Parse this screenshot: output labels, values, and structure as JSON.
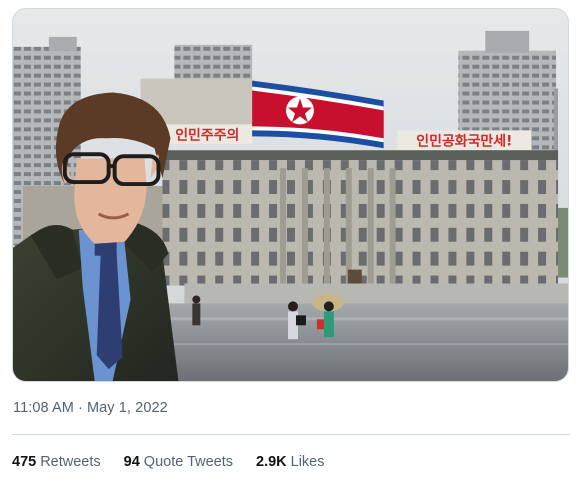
{
  "media": {
    "left_banner": "인민주주의",
    "right_banner": "인민공화국만세!",
    "colors": {
      "sky": "#d9dde0",
      "flag_red": "#c8102e",
      "flag_blue": "#1c4fa1",
      "banner_text": "#d22a2a",
      "ground": "#7d8287"
    }
  },
  "tweet": {
    "time": "11:08 AM",
    "separator": "·",
    "date": "May 1, 2022"
  },
  "stats": {
    "retweets": {
      "count": "475",
      "label": "Retweets"
    },
    "quotes": {
      "count": "94",
      "label": "Quote Tweets"
    },
    "likes": {
      "count": "2.9K",
      "label": "Likes"
    }
  }
}
